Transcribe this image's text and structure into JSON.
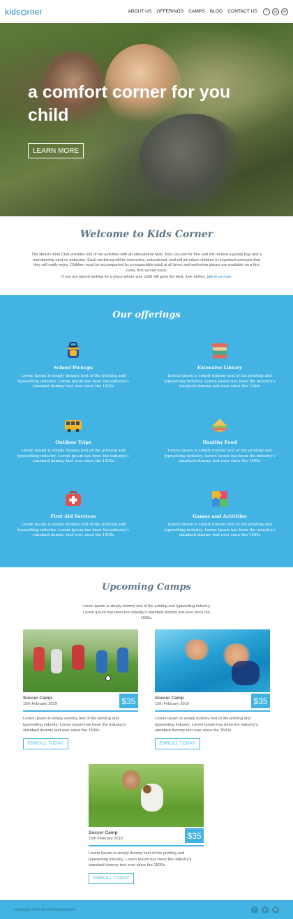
{
  "header": {
    "logo_left": "kids",
    "logo_right": "rner",
    "nav": [
      "ABOUT US",
      "OFFERINGS",
      "CAMPS",
      "BLOG",
      "CONTACT US"
    ],
    "social": [
      "f",
      "ig",
      "tw"
    ]
  },
  "hero": {
    "headline": "a comfort corner for you child",
    "cta": "LEARN MORE"
  },
  "welcome": {
    "title": "Welcome to Kids Corner",
    "body": "The Heart's Kids Club provides lots of fun activities with an educational twist. Kids can join for free and will receive a goody bag and a membership card on induction. Each workshop will be interactive, educational, and will introduce children to important concepts that they will really enjoy. Children must be accompanied by a responsible adult at all times and workshop places are available on a first come, first served basis.",
    "line2": "If you are parent looking for a place where your child will grow the best, look further, ",
    "link": "talk to us now."
  },
  "offerings": {
    "title": "Our offerings",
    "items": [
      {
        "icon": "backpack-icon",
        "title": "School Pickups",
        "desc": "Lorem Ipsum is simply dummy text of the printing and typesetting industry. Lorem Ipsum has been the industry's standard dummy text ever since the 1500s"
      },
      {
        "icon": "books-icon",
        "title": "Extensive Library",
        "desc": "Lorem Ipsum is simply dummy text of the printing and typesetting industry. Lorem Ipsum has been the industry's standard dummy text ever since the 1500s"
      },
      {
        "icon": "bus-icon",
        "title": "Outdoor Trips",
        "desc": "Lorem Ipsum is simply dummy text of the printing and typesetting industry. Lorem Ipsum has been the industry's standard dummy text ever since the 1500s"
      },
      {
        "icon": "sandwich-icon",
        "title": "Healthy Food",
        "desc": "Lorem Ipsum is simply dummy text of the printing and typesetting industry. Lorem Ipsum has been the industry's standard dummy text ever since the 1500s"
      },
      {
        "icon": "first-aid-icon",
        "title": "First Aid Services",
        "desc": "Lorem Ipsum is simply dummy text of the printing and typesetting industry. Lorem Ipsum has been the industry's standard dummy text ever since the 1500s"
      },
      {
        "icon": "puzzle-icon",
        "title": "Games and Activities",
        "desc": "Lorem Ipsum is simply dummy text of the printing and typesetting industry. Lorem Ipsum has been the industry's standard dummy text ever since the 1500s"
      }
    ]
  },
  "camps": {
    "title": "Upcoming Camps",
    "subtitle": "Lorem Ipsum is simply dummy text of the printing and typesetting industry. Lorem Ipsum has been the industry's standard dummy text ever since the 1500s.",
    "cards": [
      {
        "name": "Soccer Camp",
        "date": "15th February 2019",
        "price": "$35",
        "desc": "Lorem Ipsum is simply dummy text of the printing and typesetting industry. Lorem Ipsum has been the industry's standard dummy text ever since the 1500s",
        "button": "ENROLL TODAY"
      },
      {
        "name": "Soccer Camp",
        "date": "15th February 2019",
        "price": "$35",
        "desc": "Lorem Ipsum is simply dummy text of the printing and typesetting industry. Lorem Ipsum has been the industry's standard dummy text ever since the 1500s",
        "button": "ENROLL TODAY"
      },
      {
        "name": "Soccer Camp",
        "date": "15th February 2019",
        "price": "$35",
        "desc": "Lorem Ipsum is simply dummy text of the printing and typesetting industry. Lorem Ipsum has been the industry's standard dummy text ever since the 1500s",
        "button": "ENROLL TODAY"
      }
    ]
  },
  "footer": {
    "copyright": "Copyright 2016 All Rights Reserved",
    "social": [
      "f",
      "ig",
      "tw"
    ]
  },
  "colors": {
    "accent": "#43b3e3",
    "brand": "#1e88c9",
    "heading": "#5f7585"
  }
}
